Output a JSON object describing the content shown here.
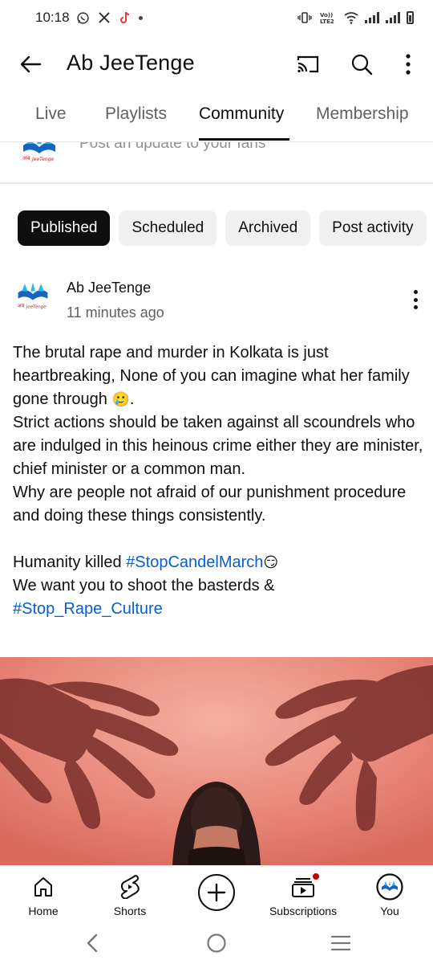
{
  "status_bar": {
    "time": "10:18",
    "left_icons": [
      "whatsapp-icon",
      "x-icon",
      "tiktok-icon",
      "dot-icon"
    ],
    "right_icons": [
      "vibrate-icon",
      "volte-icon",
      "wifi-icon",
      "signal-icon",
      "signal-icon",
      "battery-icon"
    ],
    "volte_text": "Vo))\nLTE2"
  },
  "app_bar": {
    "title": "Ab JeeTenge",
    "actions": [
      "cast-icon",
      "search-icon",
      "more-vert-icon"
    ]
  },
  "tabs": [
    {
      "label": "Live",
      "active": false
    },
    {
      "label": "Playlists",
      "active": false
    },
    {
      "label": "Community",
      "active": true
    },
    {
      "label": "Membership",
      "active": false
    }
  ],
  "composer": {
    "placeholder": "Post an update to your fans"
  },
  "filters": [
    {
      "label": "Published",
      "active": true
    },
    {
      "label": "Scheduled",
      "active": false
    },
    {
      "label": "Archived",
      "active": false
    },
    {
      "label": "Post activity",
      "active": false
    }
  ],
  "post": {
    "author": "Ab JeeTenge",
    "time": "11 minutes ago",
    "body": {
      "line1": "The brutal rape and murder in Kolkata is just heartbreaking, None of you can imagine what her family gone through ",
      "line1_emoji": "🥲",
      "line1_end": ".",
      "line2": "Strict actions should be taken against all scoundrels who are indulged in this heinous crime either they are minister, chief minister or a common man.",
      "line3": "Why are people not afraid of our punishment procedure and doing these things consistently.",
      "line4_prefix": "Humanity killed ",
      "hashtag1": "#StopCandelMarch",
      "line4_emoji": "😏",
      "line5": "We want you to shoot the basterds &",
      "hashtag2": "#Stop_Rape_Culture"
    }
  },
  "bottom_nav": {
    "home": "Home",
    "shorts": "Shorts",
    "subscriptions": "Subscriptions",
    "you": "You"
  },
  "colors": {
    "hashtag": "#065fd4",
    "text": "#0f0f0f",
    "secondary_text": "#606060",
    "chip_bg": "#f0f0f0",
    "chip_active_bg": "#0f0f0f",
    "image_bg": "#e8887a",
    "notification_dot": "#cc0000"
  }
}
